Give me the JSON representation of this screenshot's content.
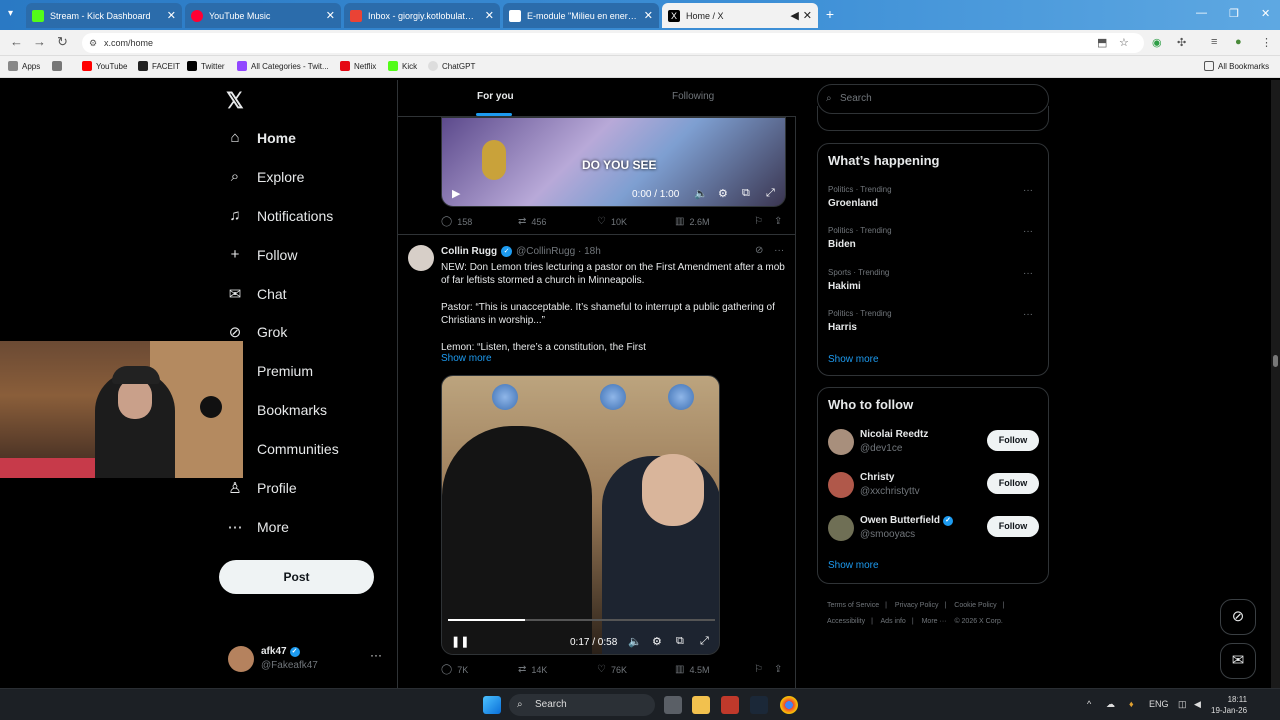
{
  "browser": {
    "tabs": [
      {
        "title": "Stream - Kick Dashboard",
        "color": "#53fc18"
      },
      {
        "title": "YouTube Music",
        "color": "#ff0033"
      },
      {
        "title": "Inbox - giorgiy.kotlobulat@vda",
        "color": "#ea4335"
      },
      {
        "title": "E-module \"Milieu en energie in",
        "color": "#2b6cab"
      },
      {
        "title": "Home / X",
        "color": "#000000"
      }
    ],
    "url": "x.com/home",
    "bookmarks": [
      {
        "label": "Apps"
      },
      {
        "label": ""
      },
      {
        "label": "YouTube"
      },
      {
        "label": "FACEIT"
      },
      {
        "label": "Twitter"
      },
      {
        "label": "All Categories - Twit..."
      },
      {
        "label": "Netflix"
      },
      {
        "label": "Kick"
      },
      {
        "label": "ChatGPT"
      }
    ],
    "all_bookmarks": "All Bookmarks"
  },
  "sidebar": {
    "items": [
      {
        "label": "Home",
        "icon": "⌂"
      },
      {
        "label": "Explore",
        "icon": "⌕"
      },
      {
        "label": "Notifications",
        "icon": "♫"
      },
      {
        "label": "Follow",
        "icon": "+"
      },
      {
        "label": "Chat",
        "icon": "✉"
      },
      {
        "label": "Grok",
        "icon": "⊘"
      },
      {
        "label": "Premium",
        "icon": "X"
      },
      {
        "label": "Bookmarks",
        "icon": "⚑"
      },
      {
        "label": "Communities",
        "icon": "⚇"
      },
      {
        "label": "Profile",
        "icon": "♙"
      },
      {
        "label": "More",
        "icon": "⋯"
      }
    ],
    "post_label": "Post",
    "account": {
      "name": "afk47",
      "handle": "@Fakeafk47"
    }
  },
  "feed": {
    "tab_foryou": "For you",
    "tab_following": "Following",
    "video1": {
      "overlay_text": "DO YOU SEE",
      "time": "0:00 / 1:00"
    },
    "tweet1_actions": {
      "replies": "158",
      "reposts": "456",
      "likes": "10K",
      "views": "2.6M"
    },
    "tweet2": {
      "name": "Collin Rugg",
      "handle": "@CollinRugg",
      "time": "18h",
      "p1": "NEW: Don Lemon tries lecturing a pastor on the First Amendment after a mob of far leftists stormed a church in Minneapolis.",
      "p2": "Pastor: “This is unacceptable. It’s shameful to interrupt a public gathering of Christians in worship...”",
      "p3": "Lemon: “Listen, there’s a constitution, the First",
      "show_more": "Show more",
      "video_time": "0:17 / 0:58",
      "video_progress": 0.29,
      "actions": {
        "replies": "7K",
        "reposts": "14K",
        "likes": "76K",
        "views": "4.5M"
      }
    }
  },
  "right": {
    "search_placeholder": "Search",
    "happening_title": "What’s happening",
    "trends": [
      {
        "category": "Politics · Trending",
        "name": "Groenland"
      },
      {
        "category": "Politics · Trending",
        "name": "Biden"
      },
      {
        "category": "Sports · Trending",
        "name": "Hakimi"
      },
      {
        "category": "Politics · Trending",
        "name": "Harris"
      }
    ],
    "show_more": "Show more",
    "who_title": "Who to follow",
    "follow_suggestions": [
      {
        "name": "Nicolai Reedtz",
        "handle": "@dev1ce",
        "verified": false,
        "avatar_color": "#a88f7c"
      },
      {
        "name": "Christy",
        "handle": "@xxchristyttv",
        "verified": false,
        "avatar_color": "#b0584a"
      },
      {
        "name": "Owen Butterfield",
        "handle": "@smooyacs",
        "verified": true,
        "avatar_color": "#6f6f55"
      }
    ],
    "follow_label": "Follow",
    "footer": [
      "Terms of Service",
      "|",
      "Privacy Policy",
      "|",
      "Cookie Policy",
      "|",
      "Accessibility",
      "|",
      "Ads info",
      "|",
      "More ···",
      "© 2026 X Corp."
    ]
  },
  "taskbar": {
    "search": "Search",
    "lang": "ENG",
    "time": "18:11",
    "date": "19-Jan-26"
  }
}
